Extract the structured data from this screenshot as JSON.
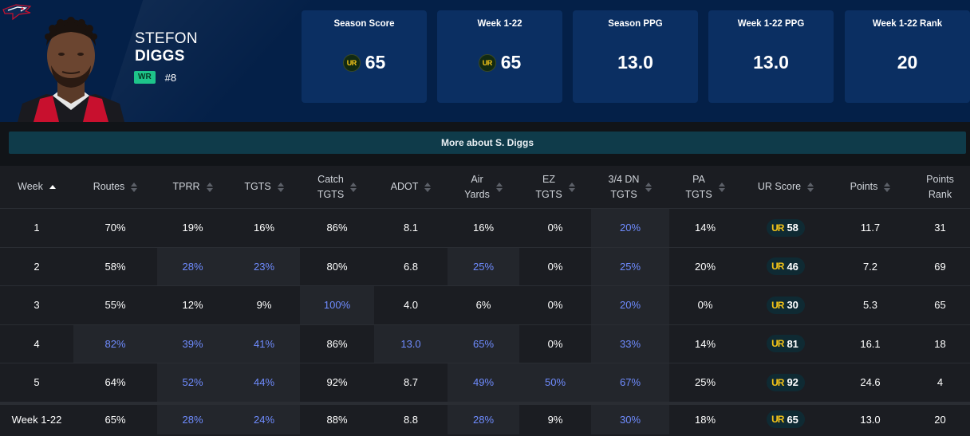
{
  "player": {
    "first_name": "STEFON",
    "last_name": "DIGGS",
    "position": "WR",
    "jersey": "#8"
  },
  "colors": {
    "header_bg": "#042048",
    "card_bg": "#0b2f62",
    "position_badge": "#1ec48a",
    "highlight_text": "#6f8cff",
    "ur_gold": "#f5c518",
    "more_button": "#0f3b4a"
  },
  "stat_cards": [
    {
      "label": "Season Score",
      "value": "65",
      "ur_logo": "UR"
    },
    {
      "label": "Week 1-22",
      "value": "65",
      "ur_logo": "UR"
    },
    {
      "label": "Season PPG",
      "value": "13.0",
      "ur_logo": ""
    },
    {
      "label": "Week 1-22 PPG",
      "value": "13.0",
      "ur_logo": ""
    },
    {
      "label": "Week 1-22 Rank",
      "value": "20",
      "ur_logo": ""
    }
  ],
  "more_button": {
    "label": "More about S. Diggs"
  },
  "table": {
    "columns": [
      {
        "line1": "Week",
        "line2": ""
      },
      {
        "line1": "Routes",
        "line2": ""
      },
      {
        "line1": "TPRR",
        "line2": ""
      },
      {
        "line1": "TGTS",
        "line2": ""
      },
      {
        "line1": "Catch",
        "line2": "TGTS"
      },
      {
        "line1": "ADOT",
        "line2": ""
      },
      {
        "line1": "Air",
        "line2": "Yards"
      },
      {
        "line1": "EZ",
        "line2": "TGTS"
      },
      {
        "line1": "3/4 DN",
        "line2": "TGTS"
      },
      {
        "line1": "PA",
        "line2": "TGTS"
      },
      {
        "line1": "UR Score",
        "line2": ""
      },
      {
        "line1": "Points",
        "line2": ""
      },
      {
        "line1": "Points",
        "line2": "Rank"
      }
    ],
    "ur_glyph": "UR",
    "rows": [
      {
        "cells": [
          "1",
          "70%",
          "19%",
          "16%",
          "86%",
          "8.1",
          "16%",
          "0%",
          "20%",
          "14%",
          "58",
          "11.7",
          "31"
        ],
        "highlight": [
          8
        ]
      },
      {
        "cells": [
          "2",
          "58%",
          "28%",
          "23%",
          "80%",
          "6.8",
          "25%",
          "0%",
          "25%",
          "20%",
          "46",
          "7.2",
          "69"
        ],
        "highlight": [
          2,
          3,
          6,
          8
        ]
      },
      {
        "cells": [
          "3",
          "55%",
          "12%",
          "9%",
          "100%",
          "4.0",
          "6%",
          "0%",
          "20%",
          "0%",
          "30",
          "5.3",
          "65"
        ],
        "highlight": [
          4,
          8
        ]
      },
      {
        "cells": [
          "4",
          "82%",
          "39%",
          "41%",
          "86%",
          "13.0",
          "65%",
          "0%",
          "33%",
          "14%",
          "81",
          "16.1",
          "18"
        ],
        "highlight": [
          1,
          2,
          3,
          5,
          6,
          8
        ]
      },
      {
        "cells": [
          "5",
          "64%",
          "52%",
          "44%",
          "92%",
          "8.7",
          "49%",
          "50%",
          "67%",
          "25%",
          "92",
          "24.6",
          "4"
        ],
        "highlight": [
          2,
          3,
          6,
          7,
          8
        ]
      },
      {
        "cells": [
          "Week 1-22",
          "65%",
          "28%",
          "24%",
          "88%",
          "8.8",
          "28%",
          "9%",
          "30%",
          "18%",
          "65",
          "13.0",
          "20"
        ],
        "highlight": [
          2,
          3,
          6,
          8
        ]
      }
    ]
  }
}
